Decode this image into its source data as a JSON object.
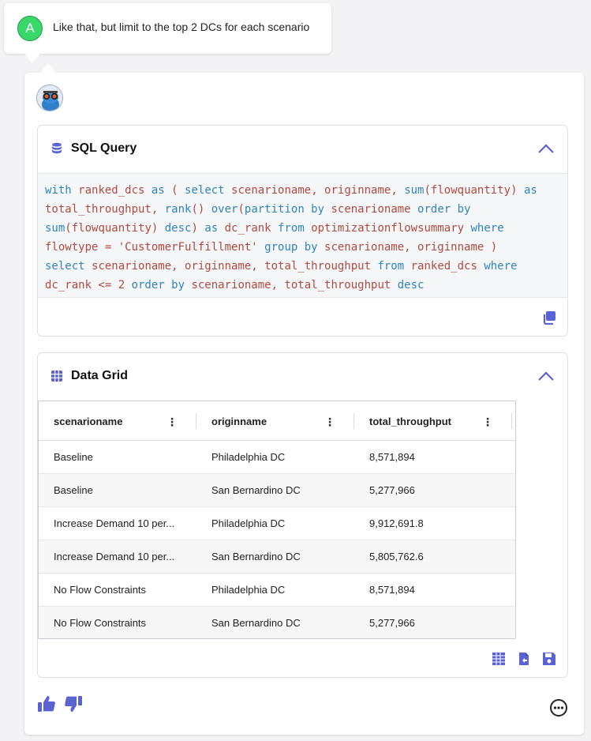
{
  "user_message": {
    "avatar_letter": "A",
    "text": "Like that, but limit to the top 2 DCs for each scenario"
  },
  "sql_panel": {
    "title": "SQL Query",
    "code": [
      [
        [
          "kw",
          "with "
        ],
        [
          "t",
          "ranked_dcs "
        ],
        [
          "kw",
          "as "
        ],
        [
          "t",
          "( "
        ],
        [
          "kw",
          "select "
        ],
        [
          "t",
          "scenarioname, originname, "
        ],
        [
          "kw",
          "sum"
        ],
        [
          "t",
          "(flowquantity) "
        ],
        [
          "kw",
          "as"
        ]
      ],
      [
        [
          "t",
          "total_throughput, "
        ],
        [
          "kw",
          "rank"
        ],
        [
          "t",
          "() "
        ],
        [
          "kw",
          "over"
        ],
        [
          "t",
          "("
        ],
        [
          "kw",
          "partition by "
        ],
        [
          "t",
          "scenarioname "
        ],
        [
          "kw",
          "order by"
        ]
      ],
      [
        [
          "kw",
          "sum"
        ],
        [
          "t",
          "(flowquantity) "
        ],
        [
          "kw",
          "desc"
        ],
        [
          "t",
          ") "
        ],
        [
          "kw",
          "as "
        ],
        [
          "t",
          "dc_rank "
        ],
        [
          "kw",
          "from "
        ],
        [
          "t",
          "optimizationflowsummary "
        ],
        [
          "kw",
          "where"
        ]
      ],
      [
        [
          "t",
          "flowtype = "
        ],
        [
          "str",
          "'CustomerFulfillment' "
        ],
        [
          "kw",
          "group by "
        ],
        [
          "t",
          "scenarioname, originname )"
        ]
      ],
      [
        [
          "kw",
          "select "
        ],
        [
          "t",
          "scenarioname, originname, total_throughput "
        ],
        [
          "kw",
          "from "
        ],
        [
          "t",
          "ranked_dcs "
        ],
        [
          "kw",
          "where"
        ]
      ],
      [
        [
          "t",
          "dc_rank <= 2 "
        ],
        [
          "kw",
          "order by "
        ],
        [
          "t",
          "scenarioname, total_throughput "
        ],
        [
          "kw",
          "desc"
        ]
      ]
    ]
  },
  "grid_panel": {
    "title": "Data Grid",
    "columns": [
      "scenarioname",
      "originname",
      "total_throughput"
    ],
    "rows": [
      [
        "Baseline",
        "Philadelphia DC",
        "8,571,894"
      ],
      [
        "Baseline",
        "San Bernardino DC",
        "5,277,966"
      ],
      [
        "Increase Demand 10 per...",
        "Philadelphia DC",
        "9,912,691.8"
      ],
      [
        "Increase Demand 10 per...",
        "San Bernardino DC",
        "5,805,762.6"
      ],
      [
        "No Flow Constraints",
        "Philadelphia DC",
        "8,571,894"
      ],
      [
        "No Flow Constraints",
        "San Bernardino DC",
        "5,277,966"
      ]
    ]
  },
  "colors": {
    "accent": "#5b63d3",
    "user_avatar": "#3ad86b"
  }
}
